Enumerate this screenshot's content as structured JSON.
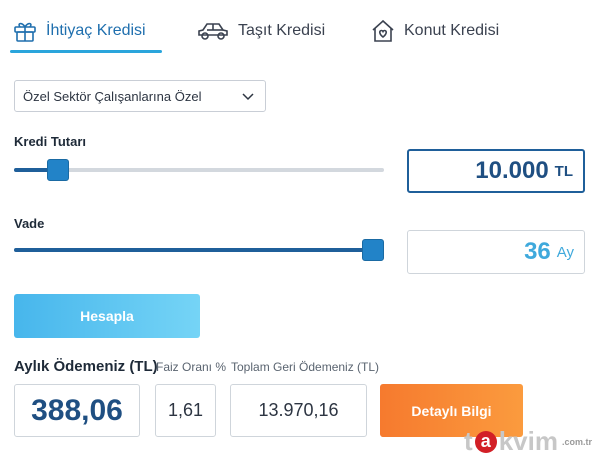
{
  "tabs": [
    {
      "label": "İhtiyaç Kredisi",
      "icon": "gift-icon",
      "active": true
    },
    {
      "label": "Taşıt Kredisi",
      "icon": "car-icon",
      "active": false
    },
    {
      "label": "Konut Kredisi",
      "icon": "house-heart-icon",
      "active": false
    }
  ],
  "colors": {
    "accent": "#2aa5dc",
    "primary_dark": "#1f4f82",
    "calc_button": "#47b6ec",
    "detail_button": "#f67a2e"
  },
  "segment_select": {
    "value": "Özel Sektör Çalışanlarına Özel",
    "icon": "chevron-down-icon"
  },
  "loan_amount": {
    "label": "Kredi Tutarı",
    "value": "10.000",
    "unit": "TL",
    "slider_fraction": 0.12
  },
  "term": {
    "label": "Vade",
    "value": "36",
    "unit": "Ay",
    "slider_fraction": 0.97
  },
  "calculate_button": "Hesapla",
  "results": {
    "monthly_payment_label": "Aylık Ödemeniz (TL)",
    "monthly_payment": "388,06",
    "interest_label": "Faiz Oranı %",
    "interest": "1,61",
    "total_label": "Toplam Geri Ödemeniz (TL)",
    "total": "13.970,16"
  },
  "detail_button": "Detaylı Bilgi",
  "watermark": {
    "prefix": "t",
    "letter": "a",
    "rest": "kvim",
    "suffix": ".com.tr"
  }
}
